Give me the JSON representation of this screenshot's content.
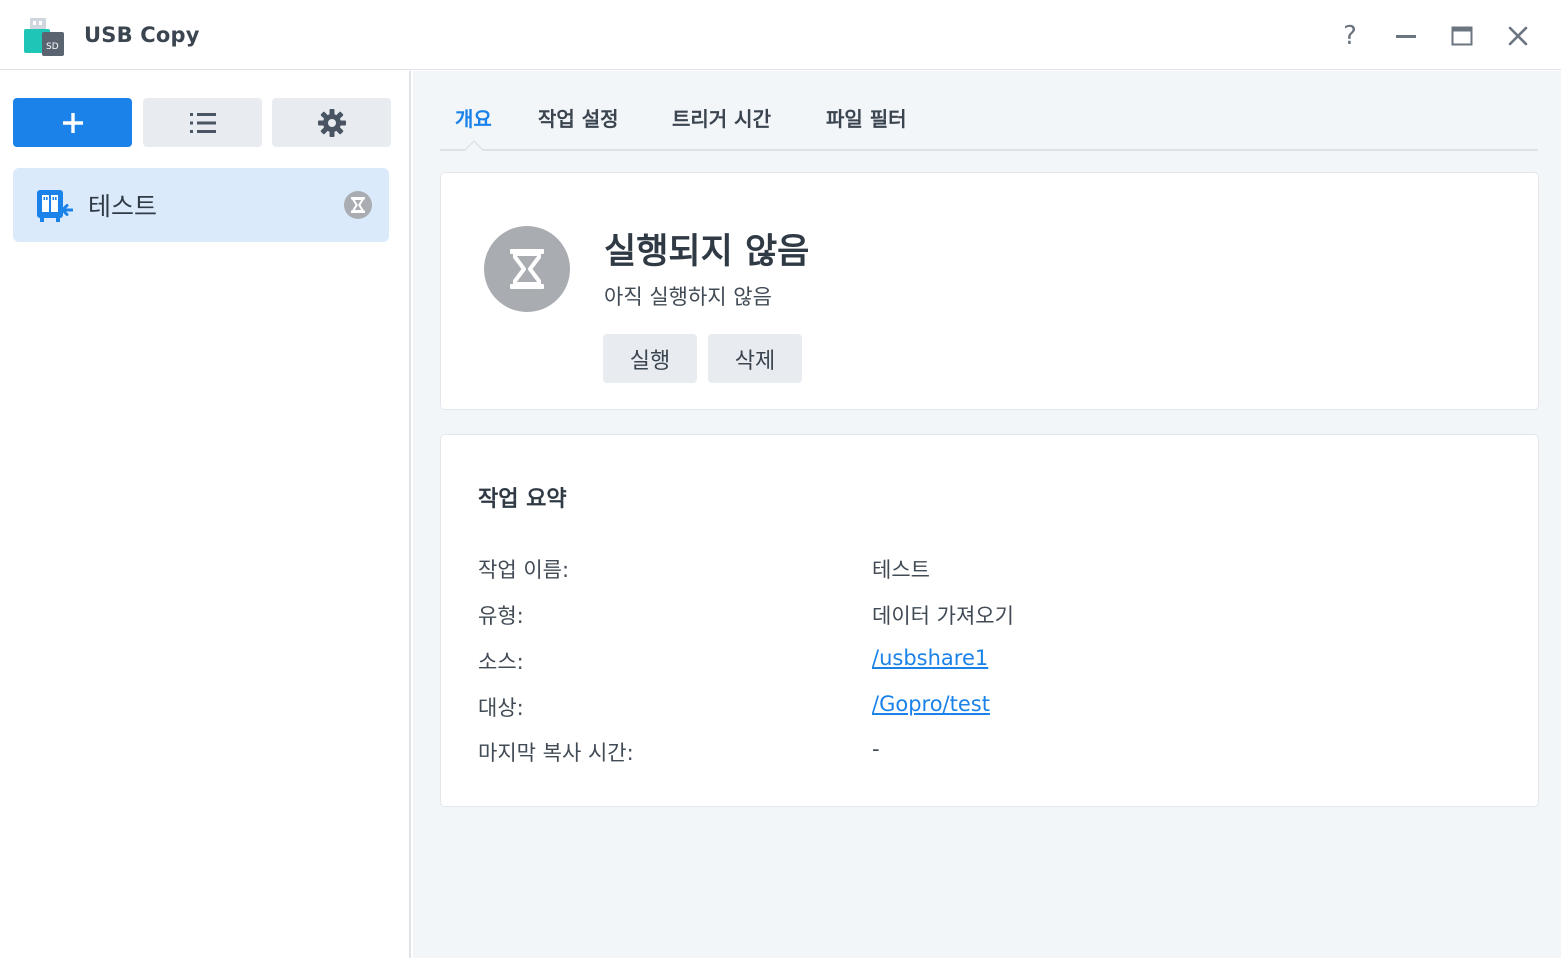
{
  "window": {
    "title": "USB Copy",
    "help_glyph": "?"
  },
  "sidebar": {
    "tasks": [
      {
        "label": "테스트",
        "status": "not-run"
      }
    ]
  },
  "tabs": [
    {
      "label": "개요",
      "active": true
    },
    {
      "label": "작업 설정",
      "active": false
    },
    {
      "label": "트리거 시간",
      "active": false
    },
    {
      "label": "파일 필터",
      "active": false
    }
  ],
  "status": {
    "title": "실행되지 않음",
    "subtitle": "아직 실행하지 않음",
    "run_label": "실행",
    "delete_label": "삭제"
  },
  "summary": {
    "title": "작업 요약",
    "rows": [
      {
        "label": "작업 이름:",
        "value": "테스트"
      },
      {
        "label": "유형:",
        "value": "데이터 가져오기"
      },
      {
        "label": "소스:",
        "value": "/usbshare1"
      },
      {
        "label": "대상:",
        "value": "/Gopro/test"
      },
      {
        "label": "마지막 복사 시간:",
        "value": "-"
      }
    ]
  },
  "colors": {
    "accent": "#1a82e8",
    "selected_bg": "#dbeafa",
    "status_grey": "#a9adb2"
  }
}
